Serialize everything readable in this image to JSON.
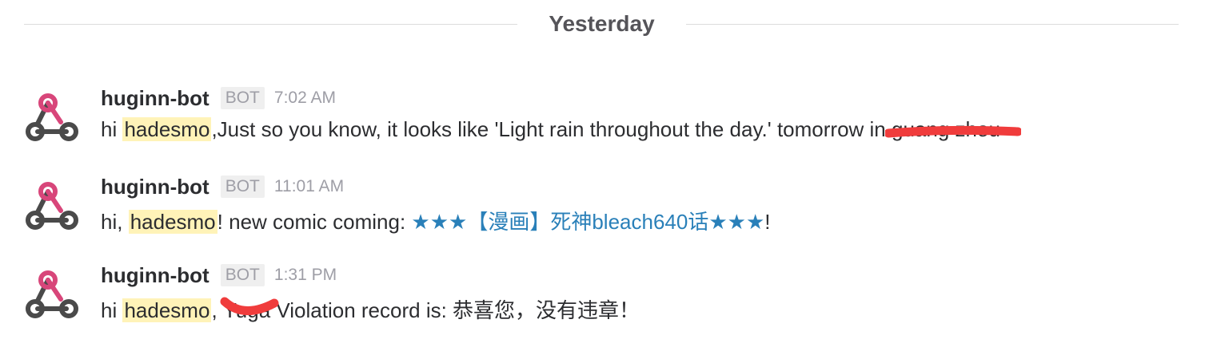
{
  "day_divider": {
    "label": "Yesterday"
  },
  "messages": [
    {
      "author": "huginn-bot",
      "badge": "BOT",
      "time": "7:02 AM",
      "prefix": "hi ",
      "mention": "hadesmo",
      "text": ",Just so you know, it looks like 'Light rain throughout the day.' tomorrow in ",
      "redacted": "guang zhou"
    },
    {
      "author": "huginn-bot",
      "badge": "BOT",
      "time": "11:01 AM",
      "prefix": "hi, ",
      "mention": "hadesmo",
      "text": "! new comic coming: ",
      "link": "★★★【漫画】死神bleach640话★★★",
      "suffix": "!"
    },
    {
      "author": "huginn-bot",
      "badge": "BOT",
      "time": "1:31 PM",
      "prefix": "hi ",
      "mention": "hadesmo",
      "text_before": ", ",
      "redacted": "Yuga",
      "text": " Violation record is: 恭喜您，没有违章！"
    }
  ],
  "colors": {
    "mention_bg": "#fff3b8",
    "link": "#2a80b9",
    "redaction": "#f03c3c",
    "avatar_pink": "#d8467a",
    "avatar_gray": "#4a4a4a"
  },
  "icons": {
    "avatar": "webhook-icon"
  }
}
